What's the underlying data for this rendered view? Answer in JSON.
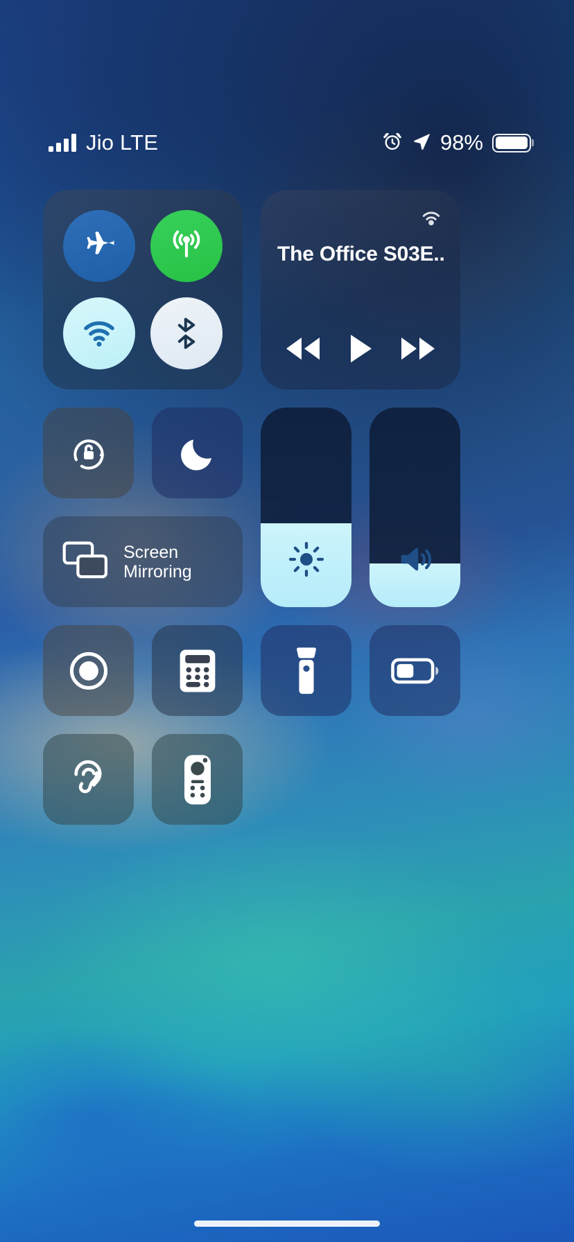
{
  "status_bar": {
    "carrier": "Jio LTE",
    "signal_bars": 4,
    "alarm_icon": "alarm-clock-icon",
    "location_icon": "location-arrow-icon",
    "battery_percent": "98%",
    "battery_level": 98
  },
  "control_center": {
    "connectivity": {
      "name": "connectivity-module",
      "toggles": [
        {
          "id": "airplane-mode",
          "label": "Airplane Mode",
          "icon": "airplane-icon",
          "state": "off",
          "color": "#2a67b2"
        },
        {
          "id": "cellular-data",
          "label": "Cellular Data",
          "icon": "cellular-antenna-icon",
          "state": "on",
          "color": "#30c84c"
        },
        {
          "id": "wifi",
          "label": "Wi-Fi",
          "icon": "wifi-icon",
          "state": "on",
          "color": "#cdf3fa"
        },
        {
          "id": "bluetooth",
          "label": "Bluetooth",
          "icon": "bluetooth-icon",
          "state": "on",
          "color": "#e7eef6"
        }
      ]
    },
    "now_playing": {
      "name": "now-playing-module",
      "title": "The Office S03E...",
      "airplay_icon": "airplay-audio-icon",
      "controls": [
        {
          "id": "rewind",
          "label": "Rewind",
          "icon": "rewind-icon"
        },
        {
          "id": "play",
          "label": "Play",
          "icon": "play-icon"
        },
        {
          "id": "forward",
          "label": "Fast Forward",
          "icon": "fast-forward-icon"
        }
      ]
    },
    "tiles": [
      {
        "id": "rotation-lock",
        "label": "Portrait Orientation Lock",
        "icon": "rotation-lock-icon",
        "state": "off",
        "tone": "warm"
      },
      {
        "id": "do-not-disturb",
        "label": "Do Not Disturb",
        "icon": "moon-icon",
        "state": "off",
        "tone": "blue"
      },
      {
        "id": "screen-recording",
        "label": "Screen Recording",
        "icon": "record-circle-icon",
        "state": "off",
        "tone": "warm"
      },
      {
        "id": "calculator",
        "label": "Calculator",
        "icon": "calculator-icon",
        "state": "off",
        "tone": "dark"
      },
      {
        "id": "flashlight",
        "label": "Flashlight",
        "icon": "flashlight-icon",
        "state": "off",
        "tone": "blue"
      },
      {
        "id": "low-power-mode",
        "label": "Low Power Mode",
        "icon": "battery-icon",
        "state": "off",
        "tone": "blue"
      },
      {
        "id": "hearing",
        "label": "Hearing",
        "icon": "ear-icon",
        "state": "off",
        "tone": "teal"
      },
      {
        "id": "apple-tv-remote",
        "label": "Apple TV Remote",
        "icon": "remote-icon",
        "state": "off",
        "tone": "teal"
      }
    ],
    "screen_mirroring": {
      "name": "screen-mirroring-tile",
      "label": "Screen\nMirroring",
      "icon": "screen-mirroring-icon"
    },
    "sliders": [
      {
        "id": "brightness",
        "label": "Brightness",
        "icon": "brightness-sun-icon",
        "value": 42
      },
      {
        "id": "volume",
        "label": "Volume",
        "icon": "speaker-volume-icon",
        "value": 22
      }
    ]
  },
  "home_indicator": {
    "name": "home-indicator"
  }
}
